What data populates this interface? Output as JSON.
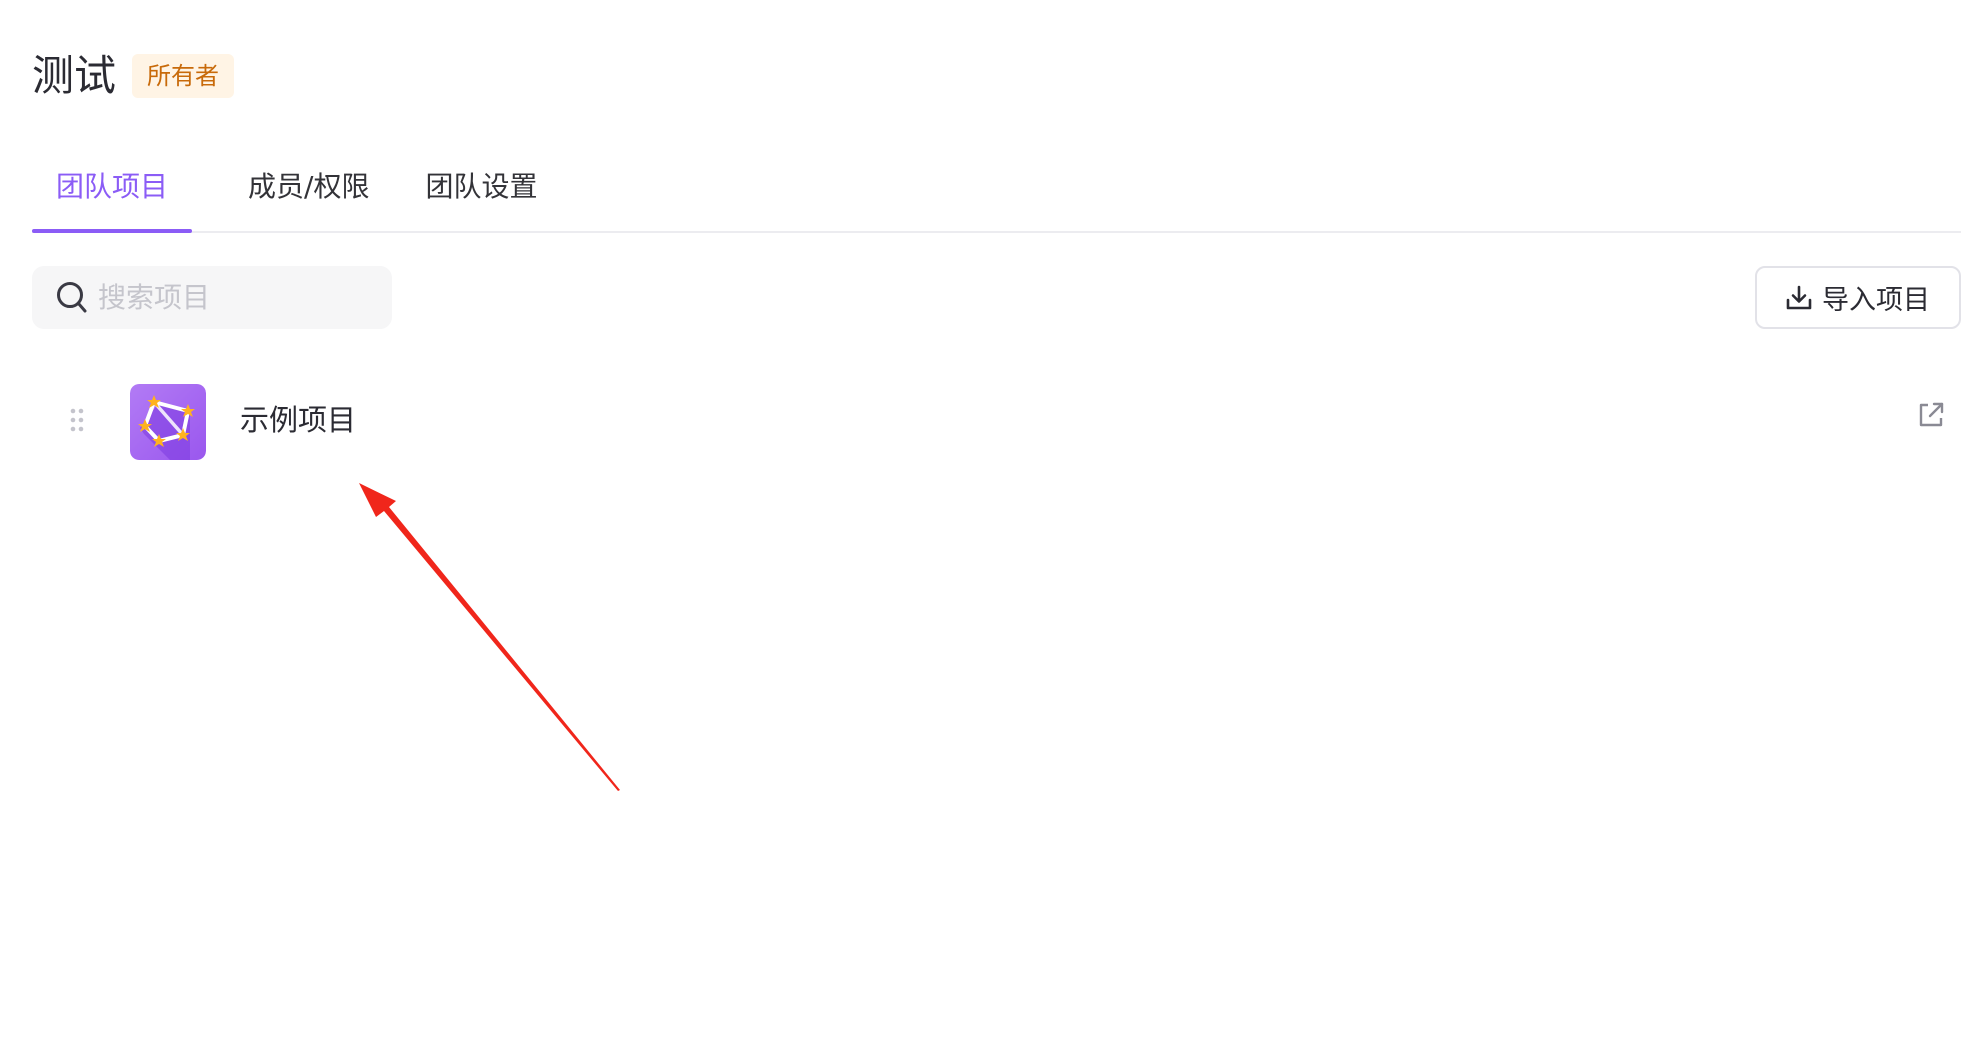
{
  "header": {
    "team_name": "测试",
    "role_badge": "所有者"
  },
  "tabs": [
    {
      "label": "团队项目",
      "active": true
    },
    {
      "label": "成员/权限",
      "active": false
    },
    {
      "label": "团队设置",
      "active": false
    }
  ],
  "search": {
    "placeholder": "搜索项目",
    "value": ""
  },
  "toolbar": {
    "import_label": "导入项目"
  },
  "projects": [
    {
      "name": "示例项目"
    }
  ],
  "colors": {
    "accent": "#8b5cf6",
    "badge_bg": "#fff4e5",
    "badge_text": "#c86a0a",
    "annotation": "#f0261b"
  },
  "icons": {
    "search": "search-icon",
    "import": "download-icon",
    "drag": "drag-handle-icon",
    "external": "open-external-icon",
    "project": "constellation-icon"
  }
}
